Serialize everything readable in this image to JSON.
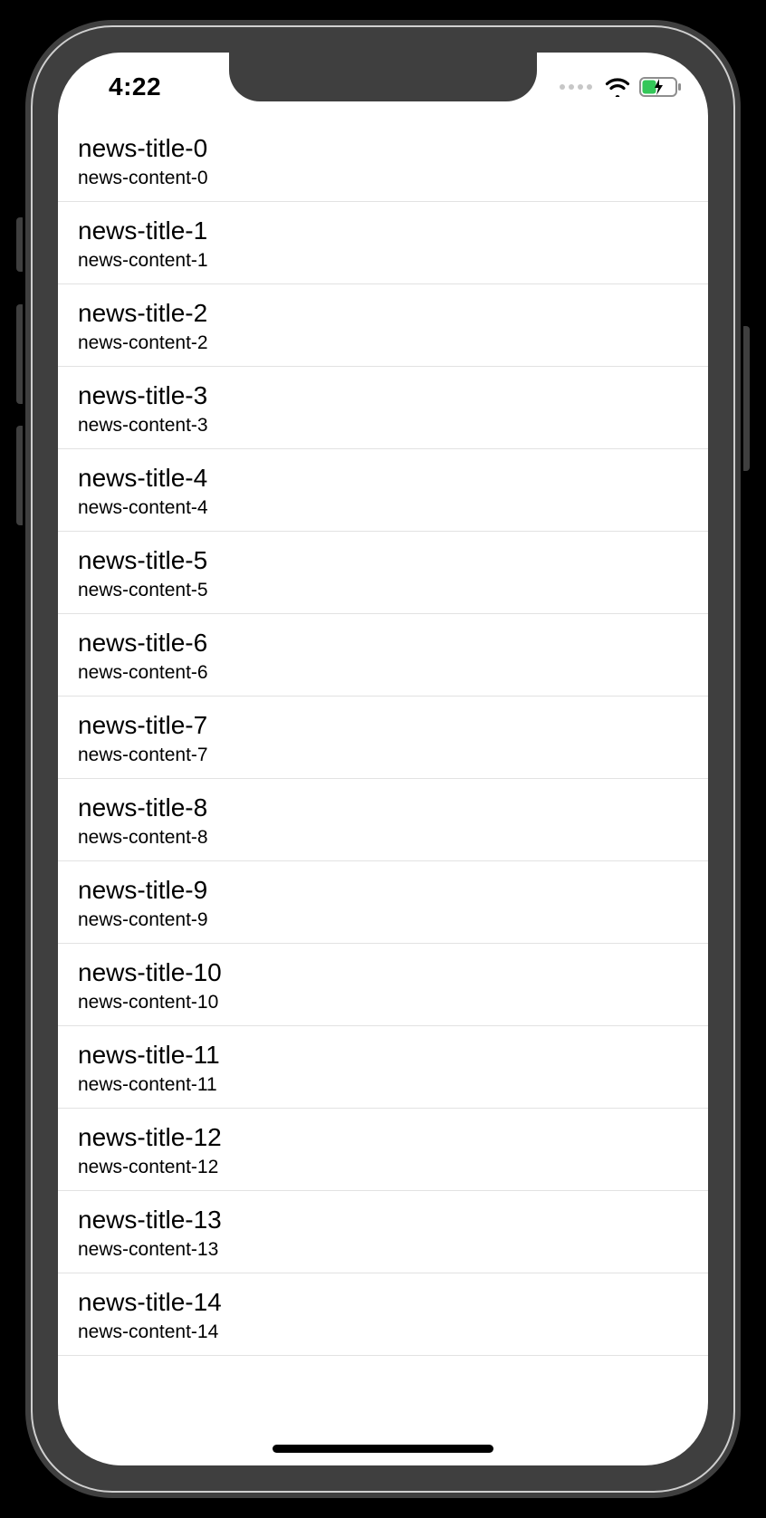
{
  "statusbar": {
    "time": "4:22"
  },
  "list": {
    "items": [
      {
        "title": "news-title-0",
        "content": "news-content-0"
      },
      {
        "title": "news-title-1",
        "content": "news-content-1"
      },
      {
        "title": "news-title-2",
        "content": "news-content-2"
      },
      {
        "title": "news-title-3",
        "content": "news-content-3"
      },
      {
        "title": "news-title-4",
        "content": "news-content-4"
      },
      {
        "title": "news-title-5",
        "content": "news-content-5"
      },
      {
        "title": "news-title-6",
        "content": "news-content-6"
      },
      {
        "title": "news-title-7",
        "content": "news-content-7"
      },
      {
        "title": "news-title-8",
        "content": "news-content-8"
      },
      {
        "title": "news-title-9",
        "content": "news-content-9"
      },
      {
        "title": "news-title-10",
        "content": "news-content-10"
      },
      {
        "title": "news-title-11",
        "content": "news-content-11"
      },
      {
        "title": "news-title-12",
        "content": "news-content-12"
      },
      {
        "title": "news-title-13",
        "content": "news-content-13"
      },
      {
        "title": "news-title-14",
        "content": "news-content-14"
      }
    ]
  }
}
